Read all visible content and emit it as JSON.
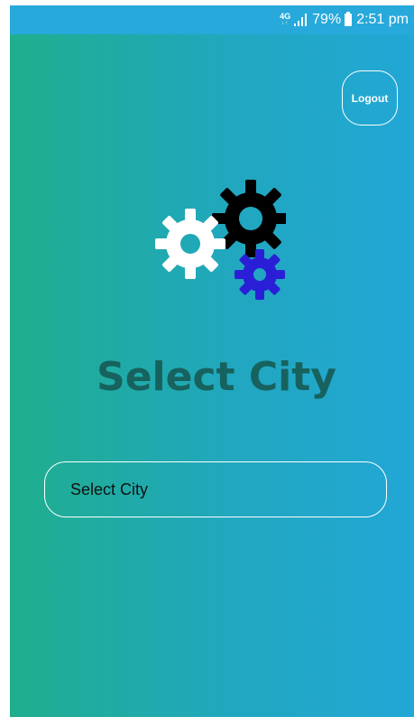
{
  "status_bar": {
    "network_type": "4G",
    "network_arrows": "↓↑",
    "battery_percent": "79%",
    "time": "2:51 pm"
  },
  "header": {
    "logout_label": "Logout"
  },
  "logo": {
    "icon": "gears-icon",
    "colors": {
      "white_gear": "#ffffff",
      "black_gear": "#000000",
      "blue_gear": "#2a1fd6"
    }
  },
  "main": {
    "title": "Select City",
    "city_select": {
      "selected_value": "Select City"
    }
  },
  "colors": {
    "gradient_start": "#1fae8d",
    "gradient_end": "#22a7d6",
    "status_bar": "#27a9db",
    "title": "#17625e"
  }
}
